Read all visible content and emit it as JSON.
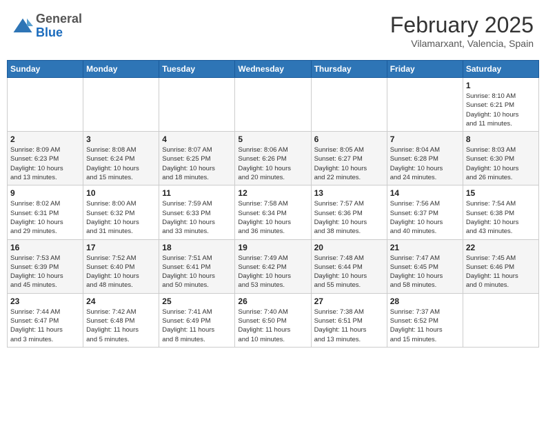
{
  "header": {
    "logo": {
      "general": "General",
      "blue": "Blue"
    },
    "month_year": "February 2025",
    "location": "Vilamarxant, Valencia, Spain"
  },
  "weekdays": [
    "Sunday",
    "Monday",
    "Tuesday",
    "Wednesday",
    "Thursday",
    "Friday",
    "Saturday"
  ],
  "weeks": [
    [
      {
        "day": "",
        "info": ""
      },
      {
        "day": "",
        "info": ""
      },
      {
        "day": "",
        "info": ""
      },
      {
        "day": "",
        "info": ""
      },
      {
        "day": "",
        "info": ""
      },
      {
        "day": "",
        "info": ""
      },
      {
        "day": "1",
        "info": "Sunrise: 8:10 AM\nSunset: 6:21 PM\nDaylight: 10 hours\nand 11 minutes."
      }
    ],
    [
      {
        "day": "2",
        "info": "Sunrise: 8:09 AM\nSunset: 6:23 PM\nDaylight: 10 hours\nand 13 minutes."
      },
      {
        "day": "3",
        "info": "Sunrise: 8:08 AM\nSunset: 6:24 PM\nDaylight: 10 hours\nand 15 minutes."
      },
      {
        "day": "4",
        "info": "Sunrise: 8:07 AM\nSunset: 6:25 PM\nDaylight: 10 hours\nand 18 minutes."
      },
      {
        "day": "5",
        "info": "Sunrise: 8:06 AM\nSunset: 6:26 PM\nDaylight: 10 hours\nand 20 minutes."
      },
      {
        "day": "6",
        "info": "Sunrise: 8:05 AM\nSunset: 6:27 PM\nDaylight: 10 hours\nand 22 minutes."
      },
      {
        "day": "7",
        "info": "Sunrise: 8:04 AM\nSunset: 6:28 PM\nDaylight: 10 hours\nand 24 minutes."
      },
      {
        "day": "8",
        "info": "Sunrise: 8:03 AM\nSunset: 6:30 PM\nDaylight: 10 hours\nand 26 minutes."
      }
    ],
    [
      {
        "day": "9",
        "info": "Sunrise: 8:02 AM\nSunset: 6:31 PM\nDaylight: 10 hours\nand 29 minutes."
      },
      {
        "day": "10",
        "info": "Sunrise: 8:00 AM\nSunset: 6:32 PM\nDaylight: 10 hours\nand 31 minutes."
      },
      {
        "day": "11",
        "info": "Sunrise: 7:59 AM\nSunset: 6:33 PM\nDaylight: 10 hours\nand 33 minutes."
      },
      {
        "day": "12",
        "info": "Sunrise: 7:58 AM\nSunset: 6:34 PM\nDaylight: 10 hours\nand 36 minutes."
      },
      {
        "day": "13",
        "info": "Sunrise: 7:57 AM\nSunset: 6:36 PM\nDaylight: 10 hours\nand 38 minutes."
      },
      {
        "day": "14",
        "info": "Sunrise: 7:56 AM\nSunset: 6:37 PM\nDaylight: 10 hours\nand 40 minutes."
      },
      {
        "day": "15",
        "info": "Sunrise: 7:54 AM\nSunset: 6:38 PM\nDaylight: 10 hours\nand 43 minutes."
      }
    ],
    [
      {
        "day": "16",
        "info": "Sunrise: 7:53 AM\nSunset: 6:39 PM\nDaylight: 10 hours\nand 45 minutes."
      },
      {
        "day": "17",
        "info": "Sunrise: 7:52 AM\nSunset: 6:40 PM\nDaylight: 10 hours\nand 48 minutes."
      },
      {
        "day": "18",
        "info": "Sunrise: 7:51 AM\nSunset: 6:41 PM\nDaylight: 10 hours\nand 50 minutes."
      },
      {
        "day": "19",
        "info": "Sunrise: 7:49 AM\nSunset: 6:42 PM\nDaylight: 10 hours\nand 53 minutes."
      },
      {
        "day": "20",
        "info": "Sunrise: 7:48 AM\nSunset: 6:44 PM\nDaylight: 10 hours\nand 55 minutes."
      },
      {
        "day": "21",
        "info": "Sunrise: 7:47 AM\nSunset: 6:45 PM\nDaylight: 10 hours\nand 58 minutes."
      },
      {
        "day": "22",
        "info": "Sunrise: 7:45 AM\nSunset: 6:46 PM\nDaylight: 11 hours\nand 0 minutes."
      }
    ],
    [
      {
        "day": "23",
        "info": "Sunrise: 7:44 AM\nSunset: 6:47 PM\nDaylight: 11 hours\nand 3 minutes."
      },
      {
        "day": "24",
        "info": "Sunrise: 7:42 AM\nSunset: 6:48 PM\nDaylight: 11 hours\nand 5 minutes."
      },
      {
        "day": "25",
        "info": "Sunrise: 7:41 AM\nSunset: 6:49 PM\nDaylight: 11 hours\nand 8 minutes."
      },
      {
        "day": "26",
        "info": "Sunrise: 7:40 AM\nSunset: 6:50 PM\nDaylight: 11 hours\nand 10 minutes."
      },
      {
        "day": "27",
        "info": "Sunrise: 7:38 AM\nSunset: 6:51 PM\nDaylight: 11 hours\nand 13 minutes."
      },
      {
        "day": "28",
        "info": "Sunrise: 7:37 AM\nSunset: 6:52 PM\nDaylight: 11 hours\nand 15 minutes."
      },
      {
        "day": "",
        "info": ""
      }
    ]
  ]
}
